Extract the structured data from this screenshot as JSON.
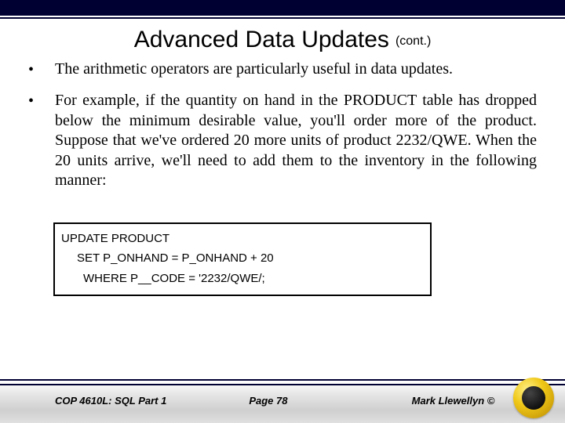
{
  "title": {
    "main": "Advanced Data Updates",
    "cont": "(cont.)"
  },
  "bullets": [
    "The arithmetic operators are particularly useful in data updates.",
    "For example, if the quantity on hand in the PRODUCT table has dropped below the minimum desirable value, you'll order more of the product.  Suppose that we've ordered 20 more units of product 2232/QWE.  When the 20 units arrive, we'll need to add them to the inventory in the following manner:"
  ],
  "code": {
    "line1": "UPDATE PRODUCT",
    "line2": "SET P_ONHAND = P_ONHAND + 20",
    "line3": "WHERE P__CODE = '2232/QWE/;"
  },
  "footer": {
    "left": "COP 4610L: SQL Part 1",
    "center": "Page 78",
    "right": "Mark Llewellyn ©"
  }
}
